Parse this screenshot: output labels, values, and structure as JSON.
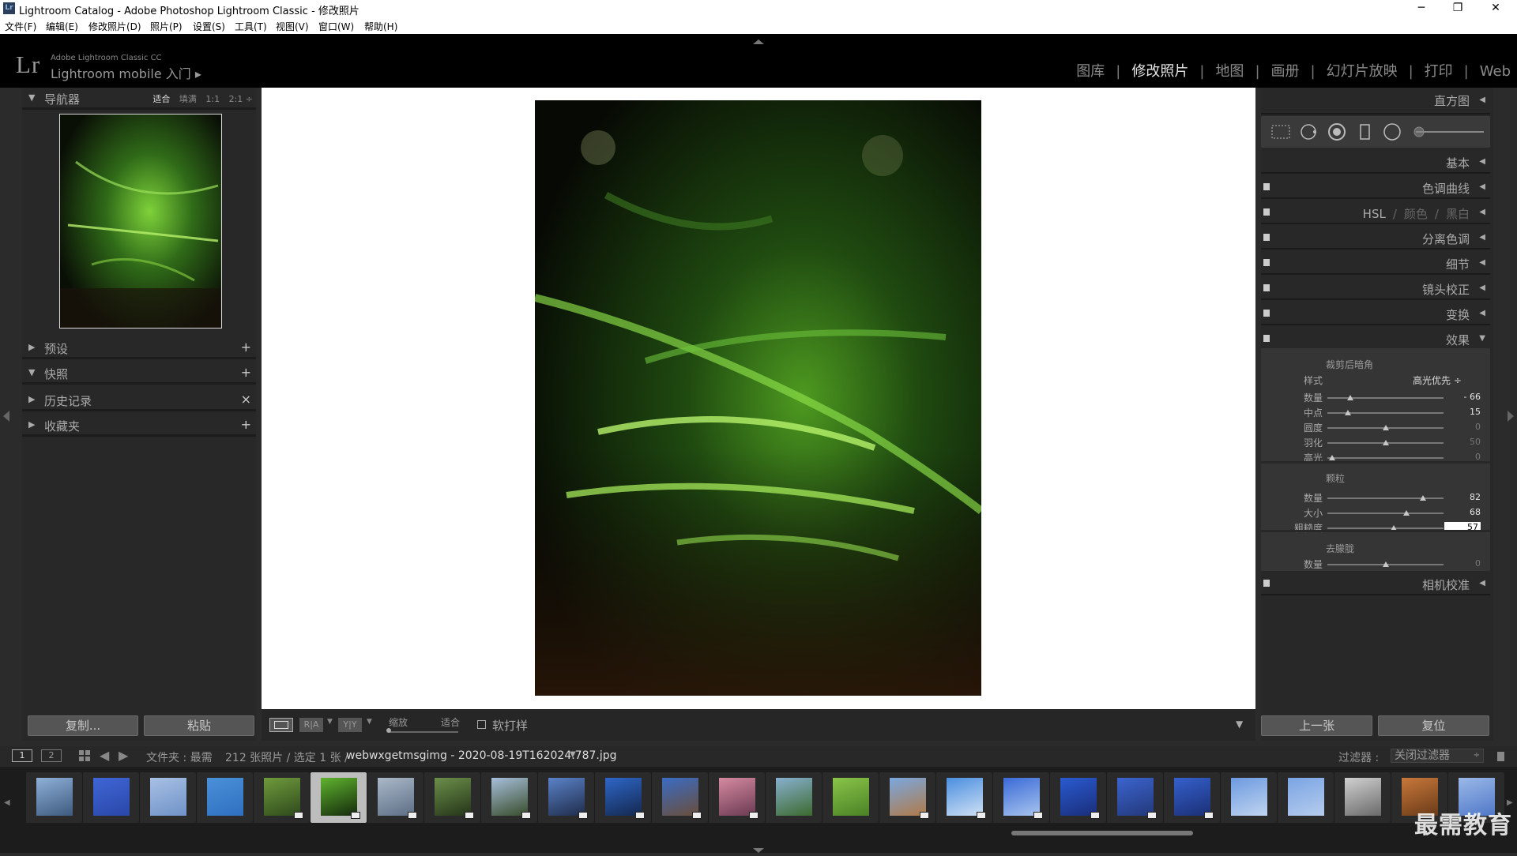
{
  "window": {
    "title": "Lightroom Catalog - Adobe Photoshop Lightroom Classic - 修改照片",
    "app_icon_text": "Lr",
    "minimize": "─",
    "restore": "❐",
    "close": "✕"
  },
  "menu": [
    "文件(F)",
    "编辑(E)",
    "修改照片(D)",
    "照片(P)",
    "设置(S)",
    "工具(T)",
    "视图(V)",
    "窗口(W)",
    "帮助(H)"
  ],
  "identity": {
    "logo": "Lr",
    "brand": "Adobe Lightroom Classic CC",
    "mobile": "Lightroom mobile 入门 ▸"
  },
  "modules": [
    {
      "label": "图库",
      "active": false
    },
    {
      "label": "修改照片",
      "active": true
    },
    {
      "label": "地图",
      "active": false
    },
    {
      "label": "画册",
      "active": false
    },
    {
      "label": "幻灯片放映",
      "active": false
    },
    {
      "label": "打印",
      "active": false
    },
    {
      "label": "Web",
      "active": false
    }
  ],
  "left": {
    "navigator": {
      "title": "导航器",
      "zoom": [
        {
          "label": "适合",
          "active": true
        },
        {
          "label": "填满",
          "active": false
        },
        {
          "label": "1:1",
          "active": false
        },
        {
          "label": "2:1 ÷",
          "active": false
        }
      ]
    },
    "panels": [
      {
        "label": "预设",
        "open": false,
        "action": "+"
      },
      {
        "label": "快照",
        "open": true,
        "action": "+"
      },
      {
        "label": "历史记录",
        "open": false,
        "action": "×"
      },
      {
        "label": "收藏夹",
        "open": false,
        "action": "+"
      }
    ],
    "copy_button": "复制...",
    "paste_button": "粘贴"
  },
  "toolbar": {
    "zoom_label": "缩放",
    "zoom_value": "适合",
    "soft_proof_label": "软打样",
    "view_mode_1": "R|A",
    "view_mode_2": "Y|Y"
  },
  "right": {
    "histogram": "直方图",
    "basic": "基本",
    "tone_curve": "色调曲线",
    "hsl": "HSL",
    "hsl_color": "颜色",
    "hsl_bw": "黑白",
    "split_toning": "分离色调",
    "detail": "细节",
    "lens": "镜头校正",
    "transform": "变换",
    "effects": "效果",
    "camera_calibration": "相机校准",
    "vignette": {
      "title": "裁剪后暗角",
      "style_label": "样式",
      "style_value": "高光优先 ÷",
      "sliders": [
        {
          "label": "数量",
          "value": "- 66",
          "pos": 0.2,
          "dim": false
        },
        {
          "label": "中点",
          "value": "15",
          "pos": 0.18,
          "dim": false
        },
        {
          "label": "圆度",
          "value": "0",
          "pos": 0.5,
          "dim": true
        },
        {
          "label": "羽化",
          "value": "50",
          "pos": 0.5,
          "dim": true
        },
        {
          "label": "高光",
          "value": "0",
          "pos": 0.04,
          "dim": true
        }
      ]
    },
    "grain": {
      "title": "颗粒",
      "sliders": [
        {
          "label": "数量",
          "value": "82",
          "pos": 0.82,
          "dim": false
        },
        {
          "label": "大小",
          "value": "68",
          "pos": 0.68,
          "dim": false
        },
        {
          "label": "粗糙度",
          "value": "57",
          "pos": 0.57,
          "dim": false
        }
      ]
    },
    "dehaze": {
      "title": "去朦胧",
      "sliders": [
        {
          "label": "数量",
          "value": "0",
          "pos": 0.5,
          "dim": true
        }
      ]
    },
    "prev_button": "上一张",
    "reset_button": "复位"
  },
  "filmstrip_bar": {
    "view1": "1",
    "view2": "2",
    "folder": "文件夹 : 最需",
    "count": "212 张照片 / 选定 1 张 /",
    "filename": "webwxgetmsgimg - 2020-08-19T162024.787.jpg",
    "filter_label": "过滤器 :",
    "filter_value": "关闭过滤器"
  },
  "filmstrip": [
    {
      "c1": "#8fb0d8",
      "c2": "#3e5a7e",
      "badge": false
    },
    {
      "c1": "#3f66d6",
      "c2": "#2a47a8",
      "badge": false
    },
    {
      "c1": "#a8c0e4",
      "c2": "#6f92c8",
      "badge": false
    },
    {
      "c1": "#4a90d8",
      "c2": "#2f70c0",
      "badge": false
    },
    {
      "c1": "#6f9a3c",
      "c2": "#2e4a1c",
      "badge": true
    },
    {
      "c1": "#5fb32e",
      "c2": "#142a0c",
      "badge": true
    },
    {
      "c1": "#aab8c8",
      "c2": "#5d6f86",
      "badge": true
    },
    {
      "c1": "#6c8f4a",
      "c2": "#243418",
      "badge": true
    },
    {
      "c1": "#a7bfdc",
      "c2": "#384c2a",
      "badge": true
    },
    {
      "c1": "#5a82c8",
      "c2": "#1f2c4a",
      "badge": true
    },
    {
      "c1": "#2e66c8",
      "c2": "#14284e",
      "badge": true
    },
    {
      "c1": "#3a6cc4",
      "c2": "#6a4e3a",
      "badge": true
    },
    {
      "c1": "#d58aa0",
      "c2": "#6a3a52",
      "badge": true
    },
    {
      "c1": "#88b0d0",
      "c2": "#3c6a2e",
      "badge": false
    },
    {
      "c1": "#8ac448",
      "c2": "#4a8226",
      "badge": false
    },
    {
      "c1": "#7aa8e0",
      "c2": "#b07a48",
      "badge": true
    },
    {
      "c1": "#4a8ee0",
      "c2": "#cfe0f4",
      "badge": true
    },
    {
      "c1": "#3a6ad8",
      "c2": "#a8c4ee",
      "badge": true
    },
    {
      "c1": "#2a5ad0",
      "c2": "#1a2e7a",
      "badge": true
    },
    {
      "c1": "#3b64cf",
      "c2": "#23387a",
      "badge": true
    },
    {
      "c1": "#3560cc",
      "c2": "#1b2f76",
      "badge": true
    },
    {
      "c1": "#6c9ae0",
      "c2": "#c0d4f0",
      "badge": false
    },
    {
      "c1": "#7aa4e4",
      "c2": "#b6ccee",
      "badge": false
    },
    {
      "c1": "#d0d0d0",
      "c2": "#6a6a6a",
      "badge": false
    },
    {
      "c1": "#c8783a",
      "c2": "#6a3a18",
      "badge": false
    },
    {
      "c1": "#9ab8e8",
      "c2": "#5078c8",
      "badge": false
    }
  ],
  "watermark": "最需教育"
}
